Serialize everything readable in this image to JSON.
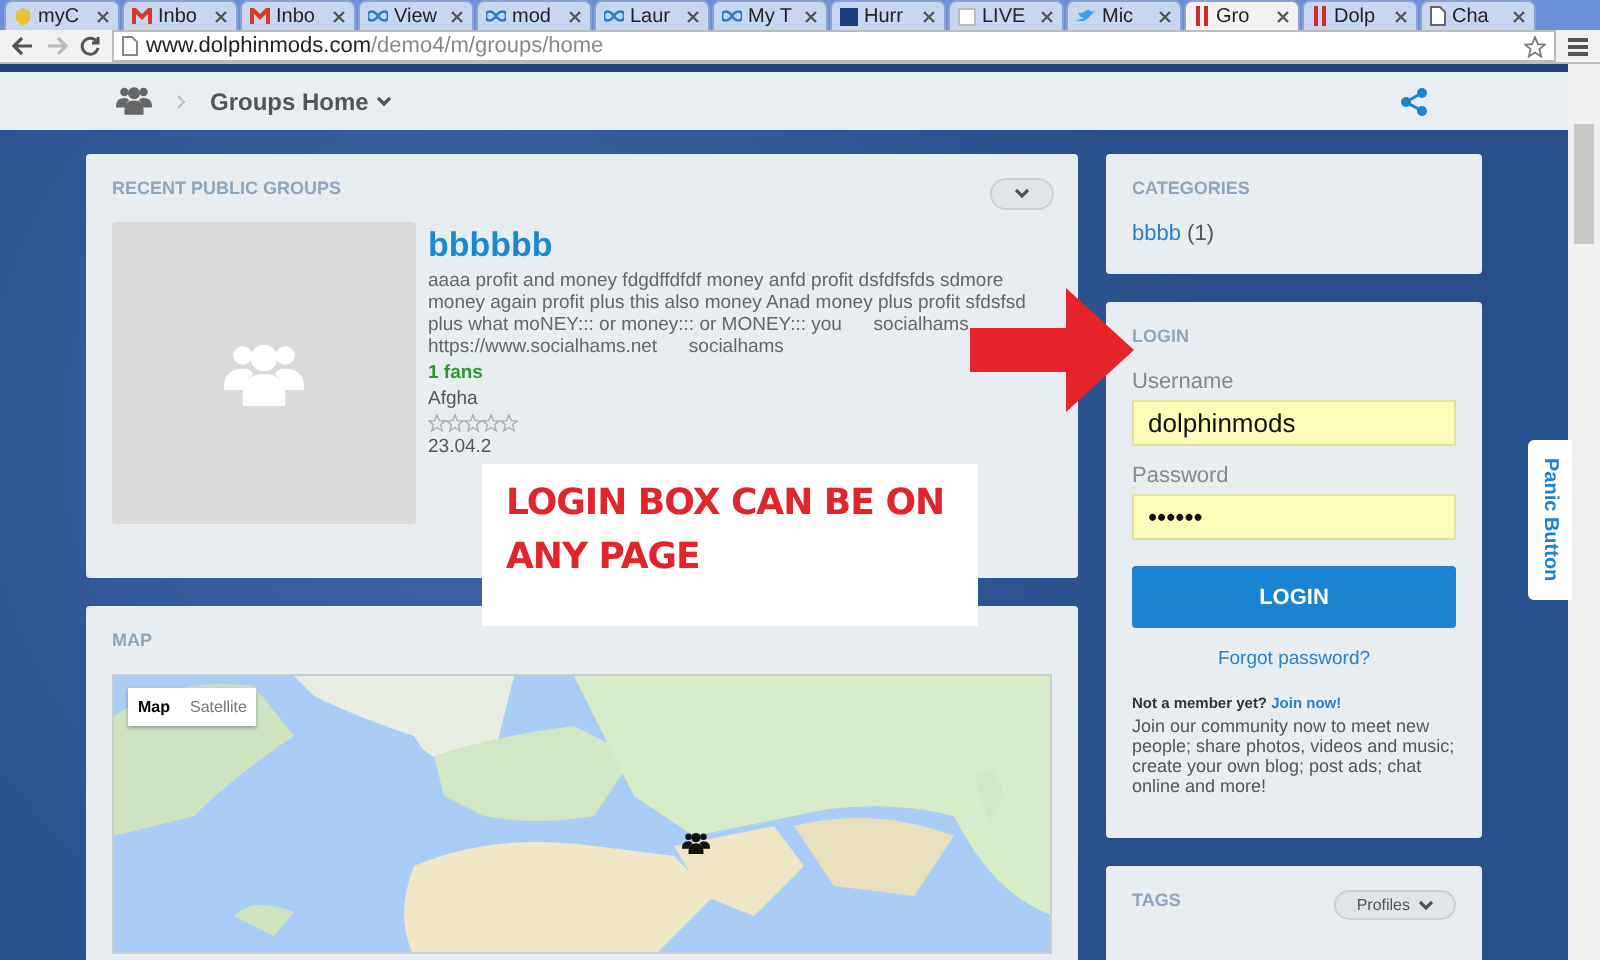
{
  "browser": {
    "tabs": [
      {
        "label": "myC",
        "selected": false,
        "kind": "shield"
      },
      {
        "label": "Inbo",
        "selected": false,
        "kind": "mail"
      },
      {
        "label": "Inbo",
        "selected": false,
        "kind": "mail"
      },
      {
        "label": "View",
        "selected": false,
        "kind": "loop"
      },
      {
        "label": "mod",
        "selected": false,
        "kind": "loop"
      },
      {
        "label": "Laur",
        "selected": false,
        "kind": "loop"
      },
      {
        "label": "My T",
        "selected": false,
        "kind": "loop"
      },
      {
        "label": "Hurr",
        "selected": false,
        "kind": "square"
      },
      {
        "label": "LIVE",
        "selected": false,
        "kind": "blank"
      },
      {
        "label": "Mic",
        "selected": false,
        "kind": "bird"
      },
      {
        "label": "Gro",
        "selected": true,
        "kind": "bars"
      },
      {
        "label": "Dolp",
        "selected": false,
        "kind": "bars"
      },
      {
        "label": "Cha",
        "selected": false,
        "kind": "page"
      }
    ],
    "url": {
      "host": "www.dolphinmods.com",
      "path": "/demo4/m/groups/home"
    }
  },
  "header": {
    "breadcrumb": "Groups Home"
  },
  "recent_groups": {
    "title": "RECENT PUBLIC GROUPS",
    "group": {
      "name": "bbbbbb",
      "description": "aaaa profit and money fdgdffdfdf money anfd profit dsfdfsfds sdmore money again profit plus this also money Anad money plus profit sfdsfsd plus what moNEY::: or money::: or MONEY::: you      socialhams https://www.socialhams.net      socialhams",
      "fans": "1 fans",
      "location": "Afgha",
      "stars": 0,
      "date": "23.04.2"
    }
  },
  "map": {
    "title": "MAP",
    "map_types": [
      {
        "label": "Map",
        "selected": true
      },
      {
        "label": "Satellite",
        "selected": false
      }
    ]
  },
  "categories": {
    "title": "CATEGORIES",
    "items": [
      {
        "name": "bbbb",
        "count": "(1)"
      }
    ]
  },
  "login": {
    "title": "LOGIN",
    "username_label": "Username",
    "username": "dolphinmods",
    "password_label": "Password",
    "password": "••••••",
    "button": "LOGIN",
    "forgot": "Forgot password?",
    "not_member": "Not a member yet?",
    "join": "Join now!",
    "pitch": "Join our community now to meet new people; share photos, videos and music; create your own blog; post ads; chat online and more!"
  },
  "tags": {
    "title": "TAGS",
    "dropdown": "Profiles"
  },
  "panic_button": "Panic Button",
  "annotation": {
    "text": "LOGIN BOX CAN BE ON ANY PAGE"
  }
}
